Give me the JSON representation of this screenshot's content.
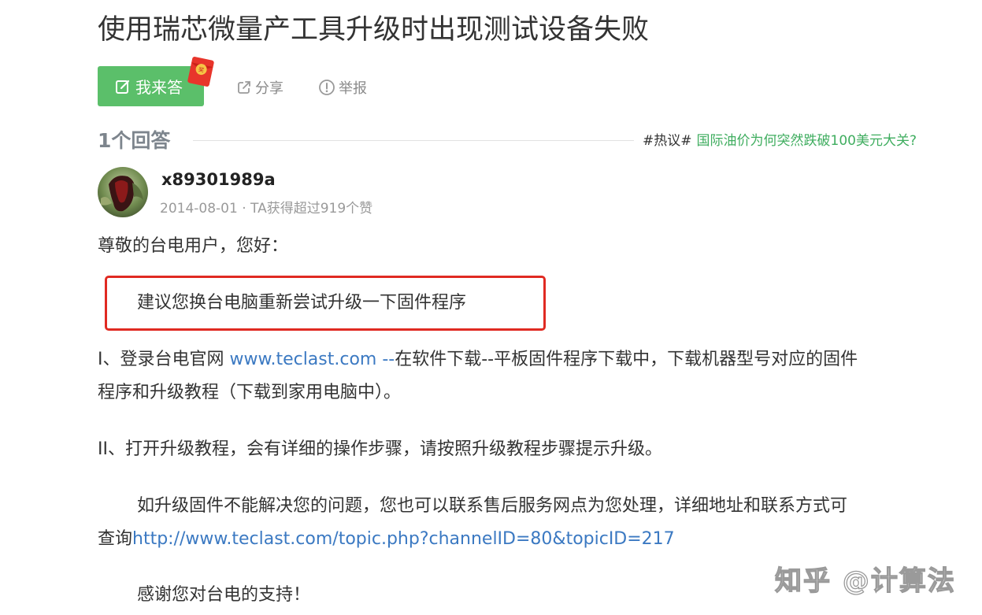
{
  "question": {
    "title": "使用瑞芯微量产工具升级时出现测试设备失败"
  },
  "actions": {
    "answer_label": "我来答",
    "share_label": "分享",
    "report_label": "举报"
  },
  "answers_header": {
    "count_label": "1个回答",
    "hot_tag": "#热议#",
    "hot_link": "国际油价为何突然跌破100美元大关?"
  },
  "answer": {
    "author": "x89301989a",
    "meta": "2014-08-01 · TA获得超过919个赞",
    "greeting": "尊敬的台电用户，您好：",
    "highlight": "建议您换台电脑重新尝试升级一下固件程序",
    "p1_prefix": "I、登录台电官网 ",
    "p1_link": "www.teclast.com --",
    "p1_suffix": "在软件下载--平板固件程序下载中，下载机器型号对应的固件",
    "p1_line2": "程序和升级教程（下载到家用电脑中）。",
    "p2": "II、打开升级教程，会有详细的操作步骤，请按照升级教程步骤提示升级。",
    "p3_line1": "如升级固件不能解决您的问题，您也可以联系售后服务网点为您处理，详细地址和联系方式可",
    "p3_prefix": "查询",
    "p3_link": "http://www.teclast.com/topic.php?channelID=80&topicID=217",
    "p4": "感谢您对台电的支持！"
  },
  "watermark": "知乎 @计算法",
  "colors": {
    "answer_button": "#5bbf6a",
    "highlight_border": "#e02a22",
    "link_blue": "#3b79c2",
    "hot_link_green": "#3fad5f"
  },
  "icons": {
    "answer": "edit-icon",
    "badge": "red-packet-icon",
    "share": "share-icon",
    "report": "report-icon"
  }
}
